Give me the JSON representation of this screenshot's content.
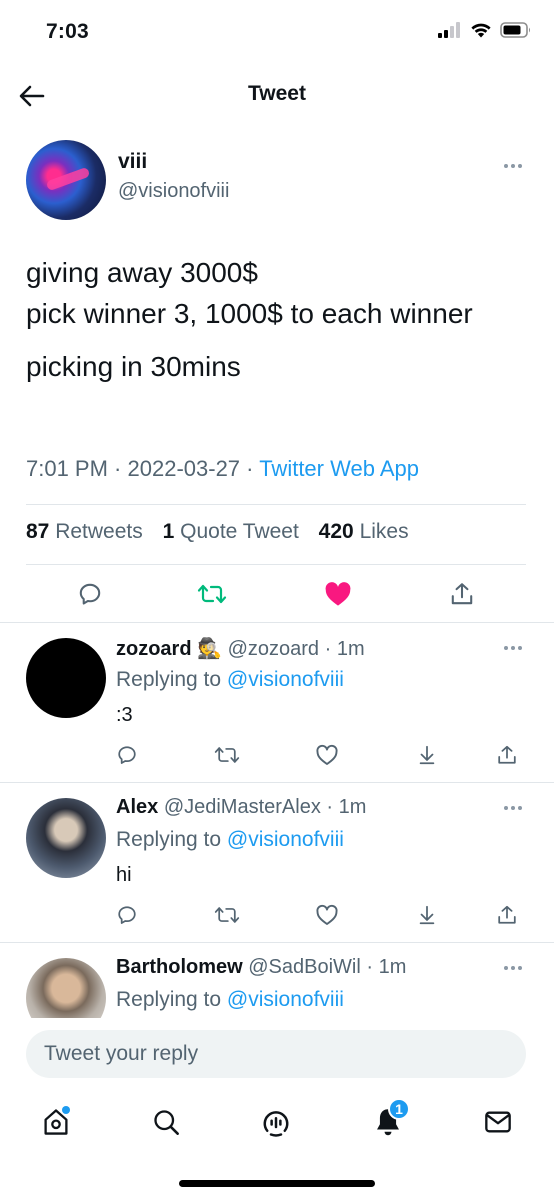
{
  "status_bar": {
    "time": "7:03"
  },
  "header": {
    "title": "Tweet"
  },
  "main_tweet": {
    "name": "viii",
    "handle": "@visionofviii",
    "text_lines": [
      "giving away 3000$",
      "pick winner 3, 1000$ to each winner",
      "picking in 30mins"
    ],
    "time": "7:01 PM",
    "date": "2022-03-27",
    "source": "Twitter Web App",
    "retweets_count": "87",
    "retweets_label": "Retweets",
    "quotes_count": "1",
    "quotes_label": "Quote Tweet",
    "likes_count": "420",
    "likes_label": "Likes"
  },
  "replies": [
    {
      "name": "zozoard",
      "emoji": "🕵",
      "handle": "@zozoard",
      "age": "1m",
      "replying_label": "Replying to",
      "replying_to": "@visionofviii",
      "text": ":3"
    },
    {
      "name": "Alex",
      "handle": "@JediMasterAlex",
      "age": "1m",
      "replying_label": "Replying to",
      "replying_to": "@visionofviii",
      "text": "hi"
    },
    {
      "name": "Bartholomew",
      "handle": "@SadBoiWil",
      "age": "1m",
      "replying_label": "Replying to",
      "replying_to": "@visionofviii",
      "text": ""
    }
  ],
  "reply_bar": {
    "placeholder": "Tweet your reply"
  },
  "bottom_nav": {
    "notifications_badge": "1"
  },
  "colors": {
    "accent": "#1d9bf0",
    "like": "#f91880",
    "retweet": "#00ba7c",
    "muted": "#536471"
  }
}
